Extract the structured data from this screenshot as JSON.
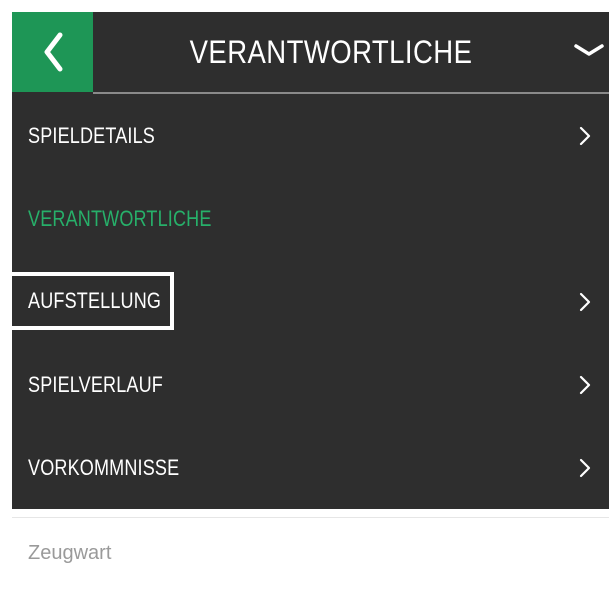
{
  "header": {
    "title": "VERANTWORTLICHE",
    "back_icon": "chevron-left-icon",
    "dropdown_icon": "chevron-down-icon"
  },
  "menu": {
    "items": [
      {
        "label": "SPIELDETAILS",
        "active": false,
        "has_chevron": true
      },
      {
        "label": "VERANTWORTLICHE",
        "active": true,
        "has_chevron": false
      },
      {
        "label": "AUFSTELLUNG",
        "active": false,
        "has_chevron": true,
        "highlighted": true
      },
      {
        "label": "SPIELVERLAUF",
        "active": false,
        "has_chevron": true
      },
      {
        "label": "VORKOMMNISSE",
        "active": false,
        "has_chevron": true
      }
    ]
  },
  "content": {
    "field_label": "Zeugwart"
  },
  "colors": {
    "header_bg": "#2e2e2e",
    "accent_green": "#1e9656",
    "active_text": "#27b06a",
    "menu_text": "#ffffff",
    "muted_text": "#9a9a9a"
  }
}
